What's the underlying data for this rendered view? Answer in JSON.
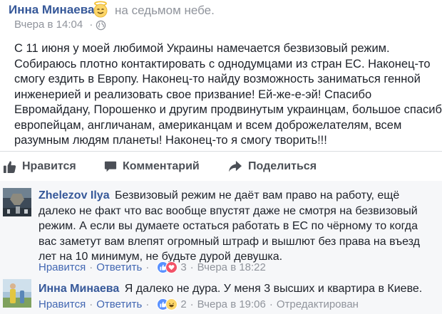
{
  "post": {
    "author": "Инна Минаева",
    "feeling": "на седьмом небе.",
    "timestamp": "Вчера в 14:04",
    "meta_separator": "·",
    "body_lines": [
      "С 11 июня у моей любимой Украины намечается безвизовый режим.",
      "Собираюсь плотно контактировать с однодумцами из стран ЕС. Наконец-то",
      "смогу ездить в Европу. Наконец-то найду возможность заниматься генной",
      "инженерией и реализовать свое призвание! Ей-же-е-эй! Спасибо",
      "Евромайдану, Порошенко и другим продвинутым украинцам, большое спасибо",
      "европейцам, англичанам, американцам и всем доброжелателям, всем",
      "разумным людям планеты! Наконец-то я смогу творить!!!"
    ]
  },
  "actions": {
    "like": "Нравится",
    "comment": "Комментарий",
    "share": "Поделиться"
  },
  "comments": [
    {
      "author": "Zhelezov Ilya",
      "lines": [
        "Безвизовый режим не даёт вам право на работу, ещё",
        "далеко не факт что вас вообще впустят даже не смотря на безвизовый",
        "режим. А если вы думаете остаться работать в ЕС по чёрному то когда",
        "вас заметут вам влепят огромный штраф и вышлют без права на въезд",
        "лет на 10 минимум, не будьте дурой девушка."
      ],
      "like_label": "Нравится",
      "reply_label": "Ответить",
      "separator": "·",
      "reaction_count": "3",
      "timestamp": "Вчера в 18:22"
    },
    {
      "author": "Инна Минаева",
      "lines": [
        "Я далеко не дура. У меня 3 высших и квартира в Киеве."
      ],
      "like_label": "Нравится",
      "reply_label": "Ответить",
      "separator": "·",
      "reaction_count": "2",
      "timestamp": "Вчера в 19:06",
      "edited_label": "Отредактирован"
    }
  ],
  "colors": {
    "author_link": "#365899",
    "action_link": "#4267b2",
    "meta_gray": "#90949c",
    "like_blue": "#5890ff",
    "love_red": "#f25268",
    "haha_yellow": "#fcd669"
  },
  "icons": [
    "halo-smile-emoji-icon",
    "globe-icon",
    "thumbs-up-icon",
    "comment-bubble-icon",
    "share-arrow-icon",
    "like-reaction-icon",
    "love-reaction-icon",
    "haha-reaction-icon"
  ]
}
